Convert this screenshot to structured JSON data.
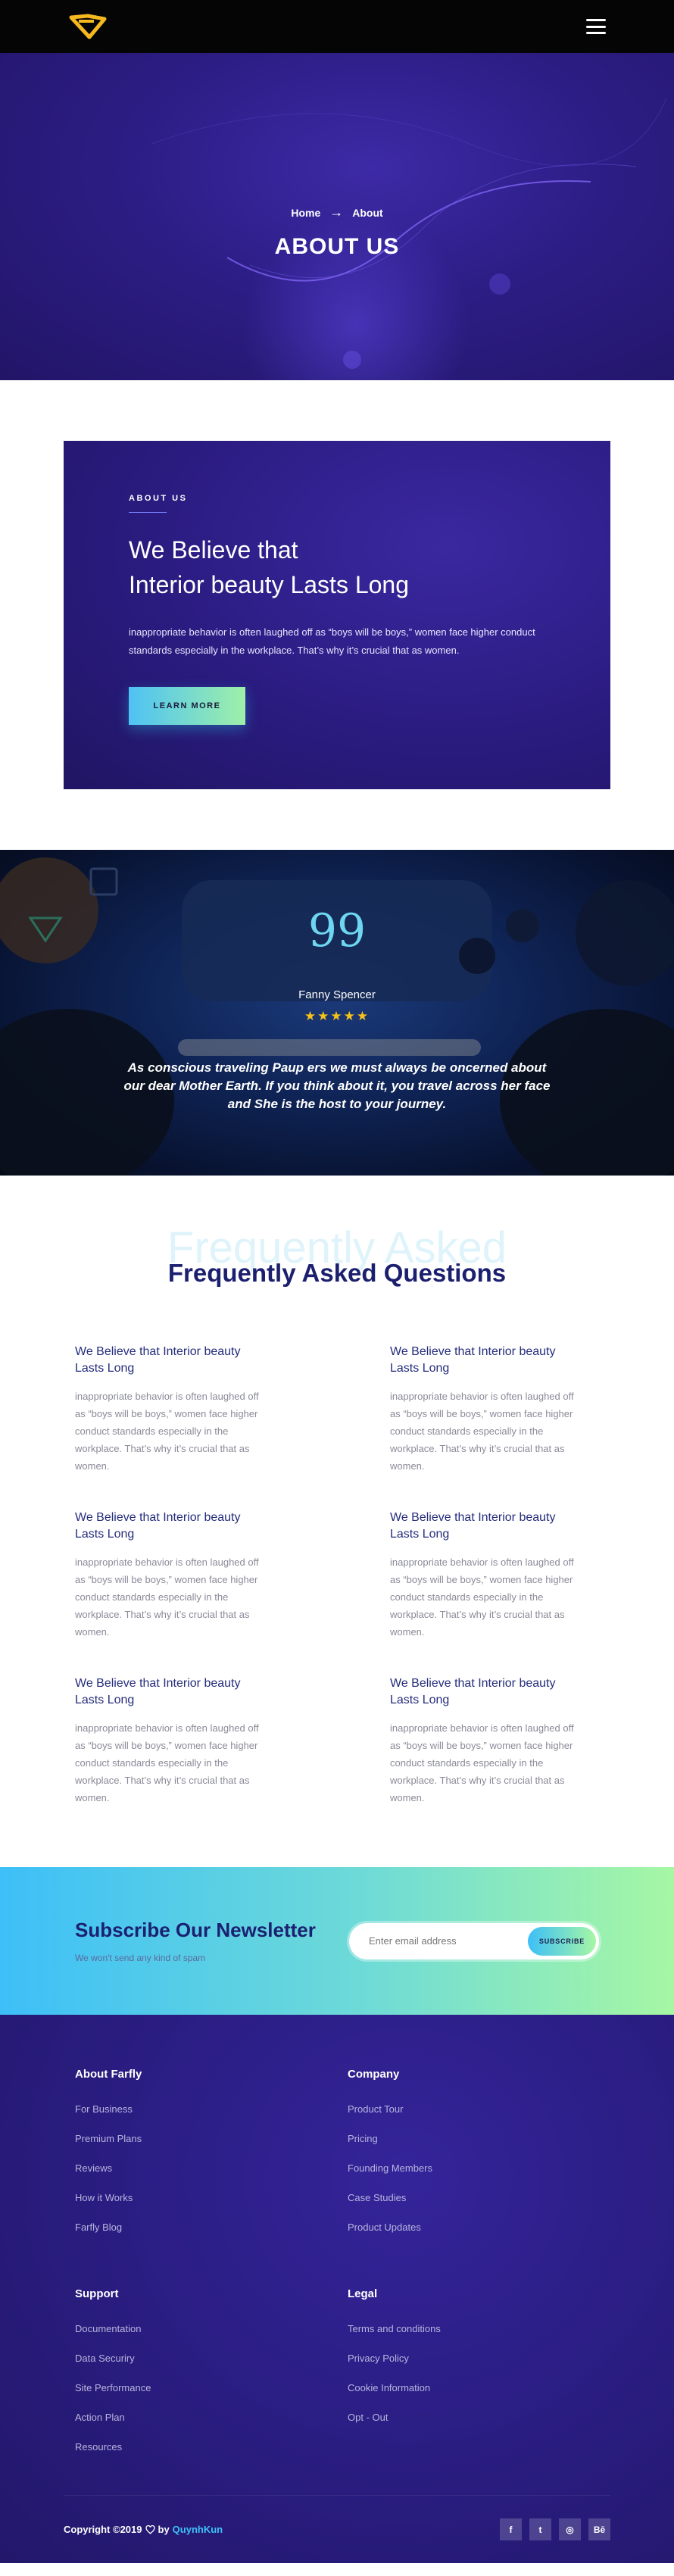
{
  "navbar": {
    "logo": "logo-icon",
    "menu_icon": "hamburger-icon"
  },
  "hero": {
    "breadcrumb": {
      "home": "Home",
      "separator": "→",
      "current": "About"
    },
    "title": "ABOUT US"
  },
  "about": {
    "label": "ABOUT US",
    "title_line1": "We Believe that",
    "title_line2": "Interior beauty Lasts Long",
    "text": "inappropriate behavior is often laughed off as “boys will be boys,” women face higher conduct standards especially in the workplace. That’s why it’s crucial that as women.",
    "button": "LEARN MORE"
  },
  "testimonial": {
    "quote_mark": "99",
    "name": "Fanny Spencer",
    "stars": "★★★★★",
    "rating": 5,
    "quote": "As conscious traveling Paup ers we must always be oncerned about our dear Mother Earth. If you think about it, you travel across her face and She is the host to your journey."
  },
  "faq": {
    "ghost_title": "Frequently Asked",
    "title": "Frequently Asked Questions",
    "items": [
      {
        "title": "We Believe that Interior beauty Lasts Long",
        "text": "inappropriate behavior is often laughed off as “boys will be boys,” women face higher conduct standards especially in the workplace. That’s why it’s crucial that as women."
      },
      {
        "title": "We Believe that Interior beauty Lasts Long",
        "text": "inappropriate behavior is often laughed off as “boys will be boys,” women face higher conduct standards especially in the workplace. That’s why it’s crucial that as women."
      },
      {
        "title": "We Believe that Interior beauty Lasts Long",
        "text": "inappropriate behavior is often laughed off as “boys will be boys,” women face higher conduct standards especially in the workplace. That’s why it’s crucial that as women."
      },
      {
        "title": "We Believe that Interior beauty Lasts Long",
        "text": "inappropriate behavior is often laughed off as “boys will be boys,” women face higher conduct standards especially in the workplace. That’s why it’s crucial that as women."
      },
      {
        "title": "We Believe that Interior beauty Lasts Long",
        "text": "inappropriate behavior is often laughed off as “boys will be boys,” women face higher conduct standards especially in the workplace. That’s why it’s crucial that as women."
      },
      {
        "title": "We Believe that Interior beauty Lasts Long",
        "text": "inappropriate behavior is often laughed off as “boys will be boys,” women face higher conduct standards especially in the workplace. That’s why it’s crucial that as women."
      }
    ]
  },
  "newsletter": {
    "title": "Subscribe Our Newsletter",
    "subtitle": "We won't send any kind of spam",
    "placeholder": "Enter email address",
    "button": "SUBSCRIBE"
  },
  "footer": {
    "columns": [
      {
        "heading": "About Farfly",
        "links": [
          "For Business",
          "Premium Plans",
          "Reviews",
          "How it Works",
          "Farfly Blog"
        ]
      },
      {
        "heading": "Company",
        "links": [
          "Product Tour",
          "Pricing",
          "Founding Members",
          "Case Studies",
          "Product Updates"
        ]
      },
      {
        "heading": "Support",
        "links": [
          "Documentation",
          "Data Securiry",
          "Site Performance",
          "Action Plan",
          "Resources"
        ]
      },
      {
        "heading": "Legal",
        "links": [
          "Terms and conditions",
          "Privacy Policy",
          "Cookie Information",
          "Opt - Out"
        ]
      }
    ],
    "copyright_prefix": "Copyright ©2019",
    "copyright_by": "by",
    "author": "QuynhKun",
    "socials": [
      {
        "icon": "facebook-icon",
        "glyph": "f"
      },
      {
        "icon": "twitter-icon",
        "glyph": "t"
      },
      {
        "icon": "dribbble-icon",
        "glyph": "◎"
      },
      {
        "icon": "behance-icon",
        "glyph": "Bē"
      }
    ]
  },
  "colors": {
    "accent_cyan": "#3ec1f7",
    "accent_green": "#a6f7a4",
    "deep_purple": "#2a1b80",
    "heading_navy": "#1b1f6e",
    "star_gold": "#f5c21a",
    "logo_gold": "#f5b820"
  }
}
